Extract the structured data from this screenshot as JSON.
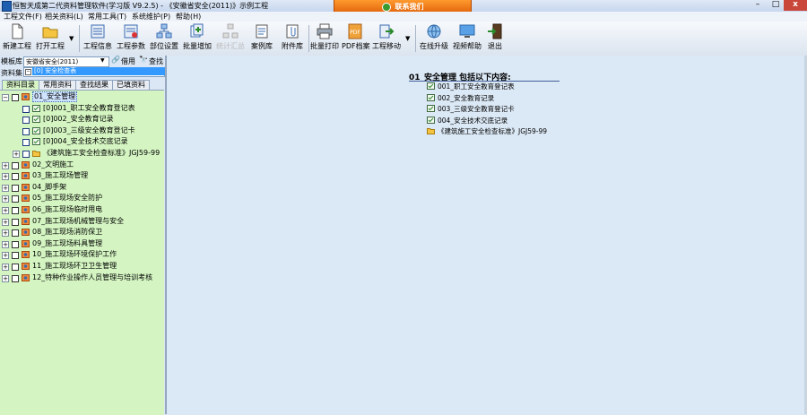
{
  "window": {
    "title": "恒智天成第二代资料管理软件(学习版 V9.2.5) - 《安徽省安全(2011)》示例工程",
    "contact_label": "联系我们",
    "min_label": "–",
    "max_label": "□",
    "close_label": "x"
  },
  "menu": {
    "items": [
      "工程文件(F)",
      "相关资料(L)",
      "常用工具(T)",
      "系统维护(P)",
      "帮助(H)"
    ]
  },
  "toolbar": {
    "new_project": "新建工程",
    "open_project": "打开工程",
    "project_info": "工程信息",
    "project_params": "工程参数",
    "unit_settings": "部位设置",
    "batch_add": "批量增加",
    "summary": "统计汇总",
    "case_library": "案例库",
    "attachment_library": "附件库",
    "batch_print": "批量打印",
    "pdf_archive": "PDF档案",
    "project_move": "工程移动",
    "online_upgrade": "在线升级",
    "video_help": "视频帮助",
    "exit": "退出"
  },
  "left_panel": {
    "template_label": "模板库",
    "template_value": "安徽省安全(2011)",
    "borrow_label": "借用",
    "find_label": "查找",
    "dataset_label": "资料集",
    "dataset_value": "[0] 安全检查表",
    "tabs": [
      "资料目录",
      "常用资料",
      "查找结果",
      "已填资料"
    ],
    "active_tab": 0,
    "tree": [
      {
        "label": "01_安全管理",
        "level": 0,
        "expanded": true,
        "selected": true
      },
      {
        "label": "[0]001_职工安全教育登记表",
        "level": 1
      },
      {
        "label": "[0]002_安全教育记录",
        "level": 1
      },
      {
        "label": "[0]003_三级安全教育登记卡",
        "level": 1
      },
      {
        "label": "[0]004_安全技术交底记录",
        "level": 1
      },
      {
        "label": "《建筑施工安全检查标准》JGJ59-99",
        "level": 1,
        "folder": true
      },
      {
        "label": "02_文明施工",
        "level": 0
      },
      {
        "label": "03_施工现场管理",
        "level": 0
      },
      {
        "label": "04_脚手架",
        "level": 0
      },
      {
        "label": "05_施工现场安全防护",
        "level": 0
      },
      {
        "label": "06_施工现场临时用电",
        "level": 0
      },
      {
        "label": "07_施工现场机械管理与安全",
        "level": 0
      },
      {
        "label": "08_施工现场消防保卫",
        "level": 0
      },
      {
        "label": "09_施工现场料具管理",
        "level": 0
      },
      {
        "label": "10_施工现场环境保护工作",
        "level": 0
      },
      {
        "label": "11_施工现场环卫卫生管理",
        "level": 0
      },
      {
        "label": "12_特种作业操作人员管理与培训考核",
        "level": 0
      }
    ]
  },
  "content": {
    "title": "01_安全管理 包括以下内容:",
    "items": [
      {
        "label": "001_职工安全教育登记表",
        "icon": "document-icon"
      },
      {
        "label": "002_安全教育记录",
        "icon": "document-icon"
      },
      {
        "label": "003_三级安全教育登记卡",
        "icon": "document-icon"
      },
      {
        "label": "004_安全技术交底记录",
        "icon": "document-icon"
      },
      {
        "label": "《建筑施工安全检查标准》JGJ59-99",
        "icon": "folder-icon"
      }
    ]
  },
  "colors": {
    "tree_bg": "#d4f5c2",
    "content_bg": "#dbe8f5",
    "selection": "#3399ff",
    "contact_btn": "#f07a18"
  }
}
